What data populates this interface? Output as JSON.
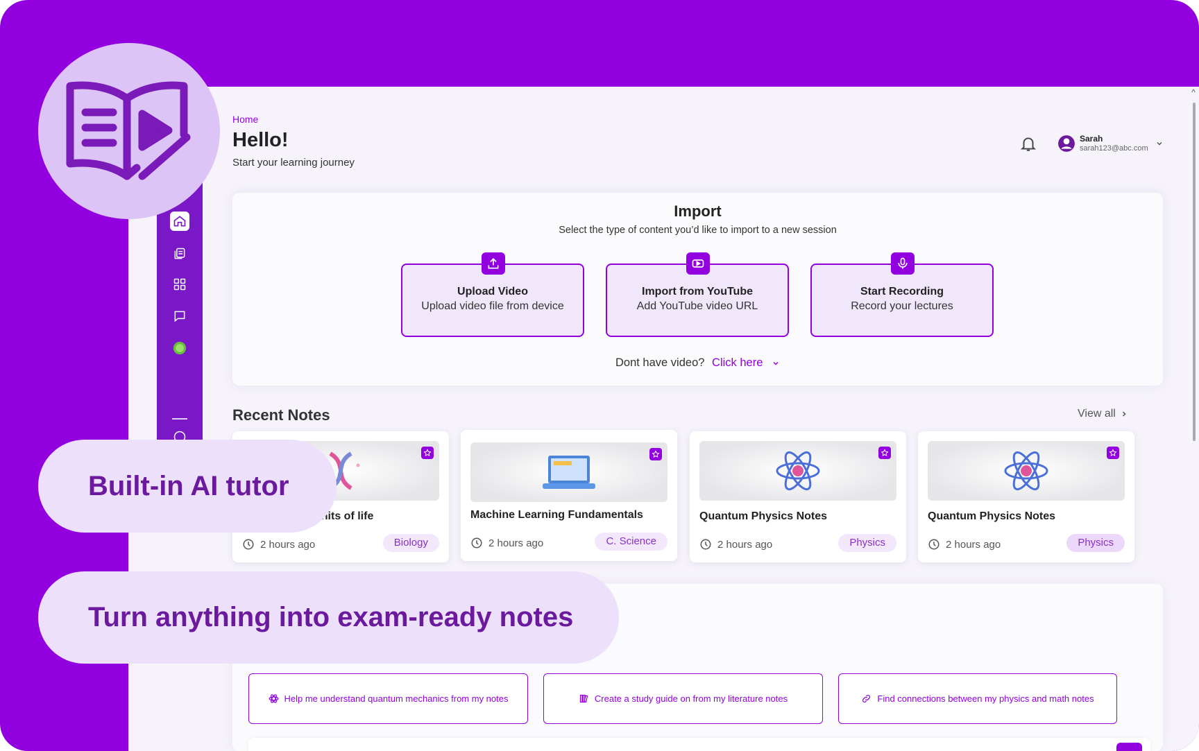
{
  "header": {
    "breadcrumb": "Home",
    "greeting": "Hello!",
    "subtitle": "Start your learning journey",
    "user": {
      "name": "Sarah",
      "email": "sarah123@abc.com"
    }
  },
  "import": {
    "title": "Import",
    "subtitle": "Select the type of content you’d like to import to a new session",
    "options": [
      {
        "title": "Upload Video",
        "desc": "Upload video file from device",
        "icon": "upload-icon"
      },
      {
        "title": "Import from YouTube",
        "desc": "Add YouTube video URL",
        "icon": "youtube-icon"
      },
      {
        "title": "Start Recording",
        "desc": "Record your lectures",
        "icon": "microphone-icon"
      }
    ],
    "no_video_text": "Dont have video?",
    "no_video_link": "Click here"
  },
  "recent_notes": {
    "title": "Recent Notes",
    "view_all": "View all",
    "items": [
      {
        "title": "Fundamental units of life",
        "visible_title": "...al units of life",
        "time": "2 hours ago",
        "tag": "Biology",
        "thumb": "dna-icon"
      },
      {
        "title": "Machine Learning Fundamentals",
        "time": "2 hours ago",
        "tag": "C. Science",
        "thumb": "laptop-icon"
      },
      {
        "title": "Quantum Physics Notes",
        "time": "2 hours ago",
        "tag": "Physics",
        "thumb": "atom-icon"
      },
      {
        "title": "Quantum Physics Notes",
        "time": "2 hours ago",
        "tag": "Physics",
        "thumb": "atom-icon"
      }
    ]
  },
  "prompts": [
    {
      "text": "Help me understand quantum mechanics from my notes",
      "icon": "atom-small-icon"
    },
    {
      "text": "Create a study guide on from my literature notes",
      "icon": "books-icon"
    },
    {
      "text": "Find connections between my physics and math notes",
      "icon": "link-icon"
    }
  ],
  "overlays": {
    "pill1": "Built-in AI tutor",
    "pill2": "Turn anything into exam-ready notes"
  },
  "colors": {
    "brand": "#9300e0",
    "sidebar": "#7a18c8",
    "pill_bg": "#ece0fb",
    "pill_text": "#6b1a9e",
    "tag_bg": "#f3e8fb"
  }
}
